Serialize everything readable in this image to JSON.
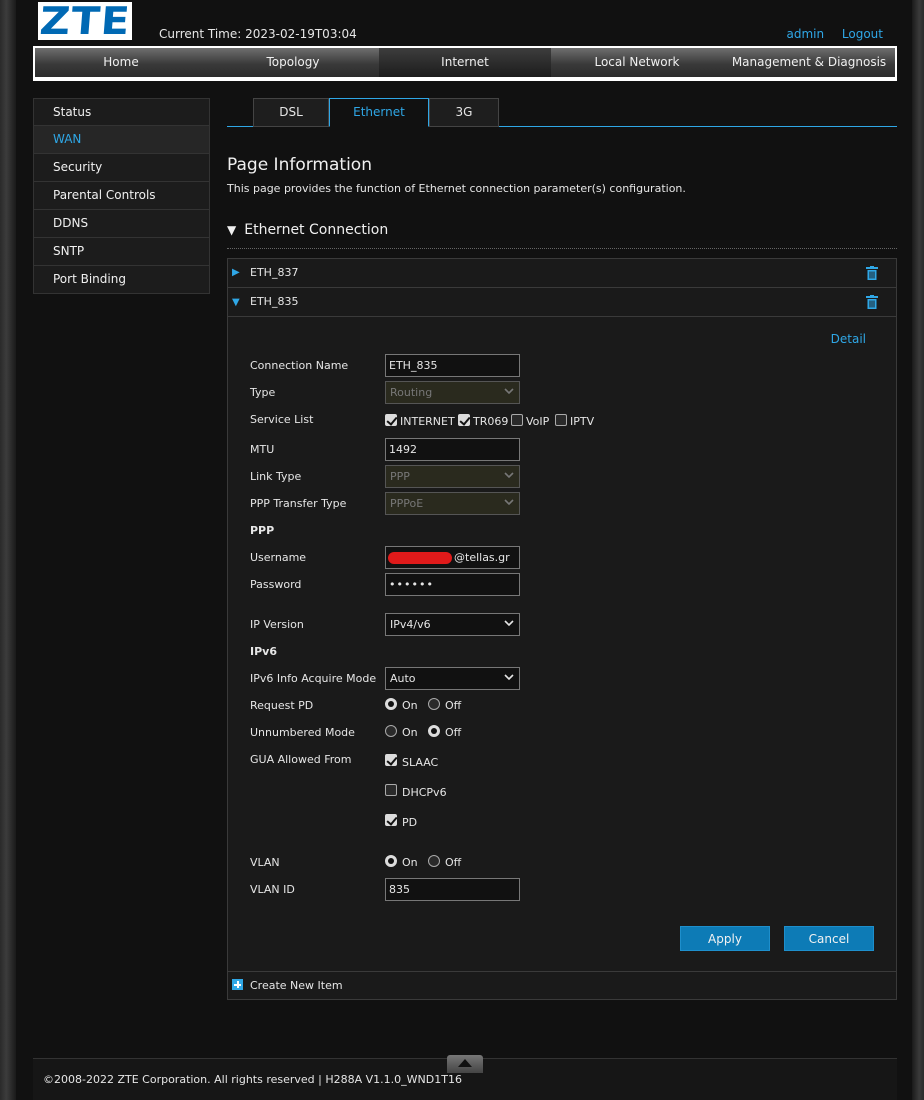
{
  "header": {
    "logo_text": "ZTE",
    "current_time": "Current Time: 2023-02-19T03:04",
    "user_link": "admin",
    "logout_link": "Logout"
  },
  "nav": {
    "items": [
      {
        "label": "Home"
      },
      {
        "label": "Topology"
      },
      {
        "label": "Internet"
      },
      {
        "label": "Local Network"
      },
      {
        "label": "Management & Diagnosis"
      }
    ],
    "active": "Internet"
  },
  "sidebar": {
    "items": [
      {
        "label": "Status"
      },
      {
        "label": "WAN"
      },
      {
        "label": "Security"
      },
      {
        "label": "Parental Controls"
      },
      {
        "label": "DDNS"
      },
      {
        "label": "SNTP"
      },
      {
        "label": "Port Binding"
      }
    ],
    "active": "WAN"
  },
  "tabs": {
    "items": [
      {
        "label": "DSL"
      },
      {
        "label": "Ethernet"
      },
      {
        "label": "3G"
      }
    ],
    "active": "Ethernet"
  },
  "page": {
    "title": "Page Information",
    "description": "This page provides the function of Ethernet connection parameter(s) configuration.",
    "section_title": "Ethernet Connection"
  },
  "connections": [
    {
      "name": "ETH_837",
      "expanded": false
    },
    {
      "name": "ETH_835",
      "expanded": true
    }
  ],
  "form": {
    "detail_link": "Detail",
    "connection_name_label": "Connection Name",
    "connection_name_value": "ETH_835",
    "type_label": "Type",
    "type_value": "Routing",
    "service_list_label": "Service List",
    "services": [
      {
        "label": "INTERNET",
        "checked": true
      },
      {
        "label": "TR069",
        "checked": true
      },
      {
        "label": "VoIP",
        "checked": false
      },
      {
        "label": "IPTV",
        "checked": false
      }
    ],
    "mtu_label": "MTU",
    "mtu_value": "1492",
    "link_type_label": "Link Type",
    "link_type_value": "PPP",
    "ppp_transfer_label": "PPP Transfer Type",
    "ppp_transfer_value": "PPPoE",
    "ppp_heading": "PPP",
    "username_label": "Username",
    "username_value": "@tellas.gr",
    "password_label": "Password",
    "password_value": "••••••",
    "ip_version_label": "IP Version",
    "ip_version_value": "IPv4/v6",
    "ipv6_heading": "IPv6",
    "ipv6_mode_label": "IPv6 Info Acquire Mode",
    "ipv6_mode_value": "Auto",
    "request_pd_label": "Request PD",
    "request_pd": "On",
    "unnumbered_label": "Unnumbered Mode",
    "unnumbered": "Off",
    "on_label": "On",
    "off_label": "Off",
    "gua_label": "GUA Allowed From",
    "gua_options": [
      {
        "label": "SLAAC",
        "checked": true
      },
      {
        "label": "DHCPv6",
        "checked": false
      },
      {
        "label": "PD",
        "checked": true
      }
    ],
    "vlan_label": "VLAN",
    "vlan": "On",
    "vlan_id_label": "VLAN ID",
    "vlan_id_value": "835",
    "apply_label": "Apply",
    "cancel_label": "Cancel",
    "create_label": "Create New Item"
  },
  "footer": {
    "text": "©2008-2022 ZTE Corporation. All rights reserved  |   H288A V1.1.0_WND1T16"
  },
  "colors": {
    "accent": "#2fa7e6",
    "button": "#0d7bb6",
    "background": "#111111",
    "redaction": "#e01a1a"
  }
}
